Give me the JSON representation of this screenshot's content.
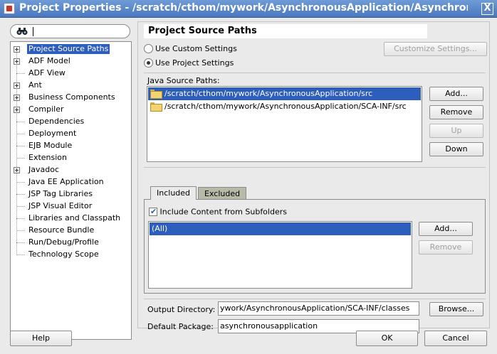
{
  "window": {
    "title": "Project Properties - /scratch/cthom/mywork/AsynchronousApplication/AsynchronousA",
    "close_glyph": "X"
  },
  "search": {
    "value": ""
  },
  "tree": {
    "items": [
      {
        "label": "Project Source Paths",
        "expandable": true,
        "selected": true
      },
      {
        "label": "ADF Model",
        "expandable": true
      },
      {
        "label": "ADF View",
        "expandable": false
      },
      {
        "label": "Ant",
        "expandable": true
      },
      {
        "label": "Business Components",
        "expandable": true
      },
      {
        "label": "Compiler",
        "expandable": true
      },
      {
        "label": "Dependencies",
        "expandable": false
      },
      {
        "label": "Deployment",
        "expandable": false
      },
      {
        "label": "EJB Module",
        "expandable": false
      },
      {
        "label": "Extension",
        "expandable": false
      },
      {
        "label": "Javadoc",
        "expandable": true
      },
      {
        "label": "Java EE Application",
        "expandable": false
      },
      {
        "label": "JSP Tag Libraries",
        "expandable": false
      },
      {
        "label": "JSP Visual Editor",
        "expandable": false
      },
      {
        "label": "Libraries and Classpath",
        "expandable": false
      },
      {
        "label": "Resource Bundle",
        "expandable": false
      },
      {
        "label": "Run/Debug/Profile",
        "expandable": false
      },
      {
        "label": "Technology Scope",
        "expandable": false
      }
    ]
  },
  "panel": {
    "title": "Project Source Paths",
    "use_custom_settings": "Use Custom Settings",
    "use_project_settings": "Use Project Settings",
    "customize_settings_button": "Customize Settings...",
    "java_source_paths_label": "Java Source Paths:",
    "source_paths": [
      "/scratch/cthom/mywork/AsynchronousApplication/src",
      "/scratch/cthom/mywork/AsynchronousApplication/SCA-INF/src"
    ],
    "add_button": "Add...",
    "remove_button": "Remove",
    "up_button": "Up",
    "down_button": "Down",
    "tabs": [
      "Included",
      "Excluded"
    ],
    "include_subfolders": "Include Content from Subfolders",
    "included_items": [
      "(All)"
    ],
    "included_add_button": "Add...",
    "included_remove_button": "Remove",
    "output_directory_label": "Output Directory:",
    "output_directory_value": "ywork/AsynchronousApplication/SCA-INF/classes",
    "browse_button": "Browse...",
    "default_package_label": "Default Package:",
    "default_package_value": "asynchronousapplication"
  },
  "footer": {
    "help_button": "Help",
    "ok_button": "OK",
    "cancel_button": "Cancel"
  }
}
